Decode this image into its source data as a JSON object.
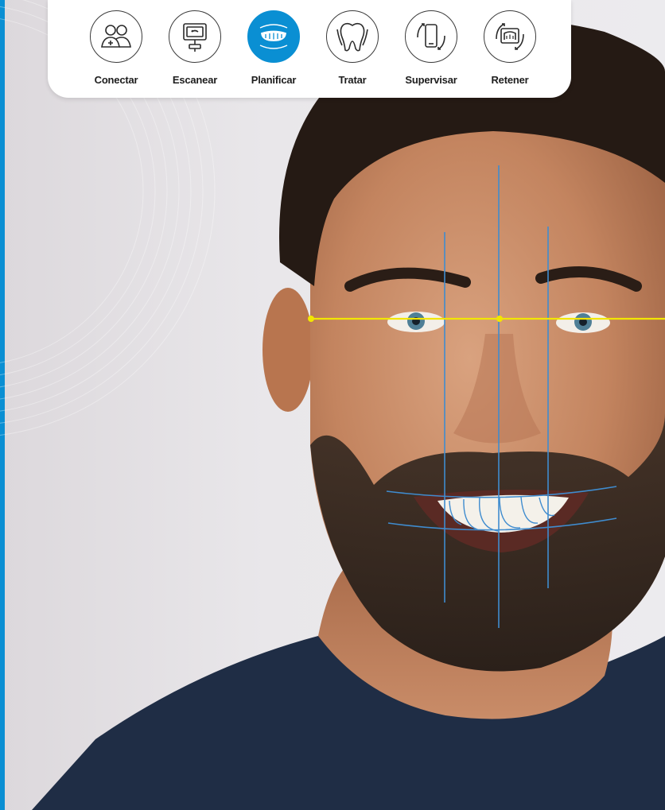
{
  "workflow": {
    "steps": [
      {
        "label": "Conectar",
        "icon": "people-icon",
        "active": false
      },
      {
        "label": "Escanear",
        "icon": "scanner-icon",
        "active": false
      },
      {
        "label": "Planificar",
        "icon": "aligner-icon",
        "active": true
      },
      {
        "label": "Tratar",
        "icon": "tooth-icon",
        "active": false
      },
      {
        "label": "Supervisar",
        "icon": "phone-monitor-icon",
        "active": false
      },
      {
        "label": "Retener",
        "icon": "retainer-case-icon",
        "active": false
      }
    ]
  },
  "colors": {
    "accent": "#0a8fd3",
    "guide_line": "#f2e600",
    "face_line": "#3f8ccf",
    "shirt": "#1f2d45"
  }
}
